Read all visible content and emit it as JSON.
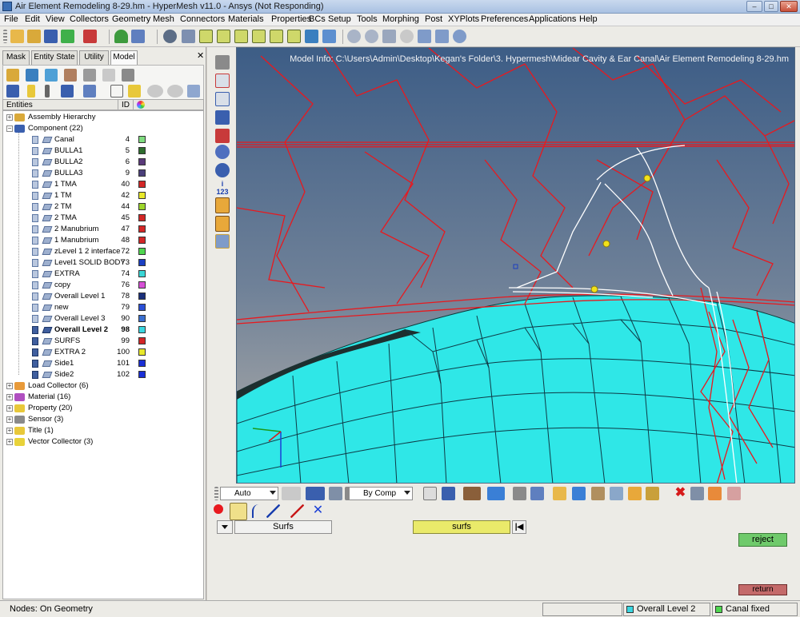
{
  "window": {
    "title": "Air Element Remodeling 8-29.hm - HyperMesh v11.0 - Ansys (Not Responding)"
  },
  "menu": [
    "File",
    "Edit",
    "View",
    "Collectors",
    "Geometry",
    "Mesh",
    "Connectors",
    "Materials",
    "Properties",
    "BCs",
    "Setup",
    "Tools",
    "Morphing",
    "Post",
    "XYPlots",
    "Preferences",
    "Applications",
    "Help"
  ],
  "tabs": [
    "Mask",
    "Entity State",
    "Utility",
    "Model"
  ],
  "entities_header": {
    "entities": "Entities",
    "id": "ID"
  },
  "tree": {
    "assembly": "Assembly Hierarchy",
    "component": "Component (22)",
    "components": [
      {
        "name": "Canal",
        "id": "4",
        "color": "#7fdc7f"
      },
      {
        "name": "BULLA1",
        "id": "5",
        "color": "#2f6e2f"
      },
      {
        "name": "BULLA2",
        "id": "6",
        "color": "#5a3a7a"
      },
      {
        "name": "BULLA3",
        "id": "9",
        "color": "#4a3f7a"
      },
      {
        "name": "1 TMA",
        "id": "40",
        "color": "#d32626"
      },
      {
        "name": "1 TM",
        "id": "42",
        "color": "#e8e82a"
      },
      {
        "name": "2 TM",
        "id": "44",
        "color": "#9dd62a"
      },
      {
        "name": "2 TMA",
        "id": "45",
        "color": "#d32626"
      },
      {
        "name": "2 Manubrium",
        "id": "47",
        "color": "#d32626"
      },
      {
        "name": "1 Manubrium",
        "id": "48",
        "color": "#d32626"
      },
      {
        "name": "zLevel 1 2 interface",
        "id": "72",
        "color": "#4fd64f"
      },
      {
        "name": "Level1 SOLID BODY",
        "id": "73",
        "color": "#1a3fc2"
      },
      {
        "name": "EXTRA",
        "id": "74",
        "color": "#3ad6d6"
      },
      {
        "name": "copy",
        "id": "76",
        "color": "#d64fd6"
      },
      {
        "name": "Overall Level 1",
        "id": "78",
        "color": "#1a2f7a"
      },
      {
        "name": "new",
        "id": "79",
        "color": "#2a4fd6"
      },
      {
        "name": "Overall Level 3",
        "id": "90",
        "color": "#3a6fd0"
      },
      {
        "name": "Overall Level 2",
        "id": "98",
        "color": "#3ad6e0",
        "bold": true
      },
      {
        "name": "SURFS",
        "id": "99",
        "color": "#d32626"
      },
      {
        "name": "EXTRA 2",
        "id": "100",
        "color": "#e8e82a"
      },
      {
        "name": "Side1",
        "id": "101",
        "color": "#1a2fd6"
      },
      {
        "name": "Side2",
        "id": "102",
        "color": "#1a2fd6"
      }
    ],
    "collectors": [
      {
        "name": "Load Collector (6)",
        "color": "#e89a3a"
      },
      {
        "name": "Material (16)",
        "color": "#b04fc0"
      },
      {
        "name": "Property (20)",
        "color": "#e8c83a"
      },
      {
        "name": "Sensor (3)",
        "color": "#8a8a8a"
      },
      {
        "name": "Title (1)",
        "color": "#e8c83a"
      },
      {
        "name": "Vector Collector (3)",
        "color": "#e8d23a"
      }
    ]
  },
  "viewport": {
    "model_info": "Model Info: C:\\Users\\Admin\\Desktop\\Kegan's Folder\\3. Hypermesh\\Midear Cavity & Ear Canal\\Air Element Remodeling 8-29.hm"
  },
  "bottom": {
    "view_select": "Auto",
    "color_select": "By Comp",
    "mode_button": "Surfs",
    "collector": "surfs",
    "reject": "reject",
    "return": "return"
  },
  "status": {
    "left": "Nodes: On Geometry",
    "component": "Overall Level 2",
    "component_color": "#3ad6e0",
    "loadcol": "Canal fixed",
    "loadcol_color": "#4fd64f"
  },
  "colors": {
    "mesh_fill": "#2fe7e7",
    "curves": "#e8191e",
    "highlight": "#ffffff"
  }
}
